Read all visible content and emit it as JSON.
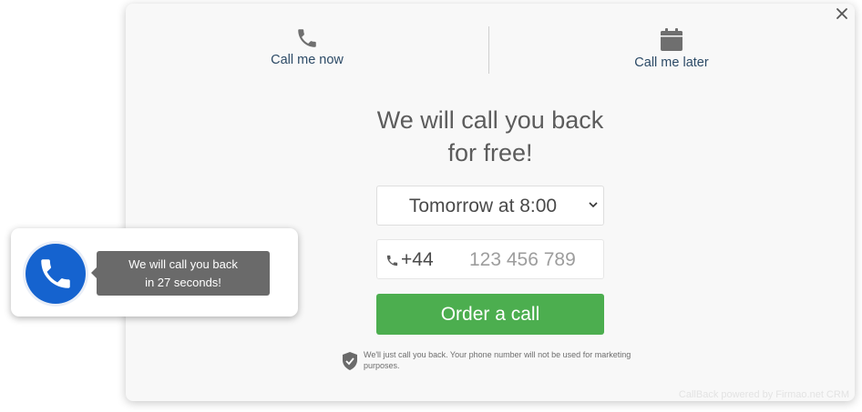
{
  "tabs": {
    "call_now": {
      "label": "Call me now",
      "icon": "phone-icon"
    },
    "call_later": {
      "label": "Call me later",
      "icon": "calendar-icon"
    }
  },
  "close": {
    "icon": "close-icon"
  },
  "headline": {
    "line1": "We will call you back",
    "line2": "for free!"
  },
  "time_select": {
    "selected": "Tomorrow at 8:00",
    "icon": "chevron-down-icon"
  },
  "phone_field": {
    "prefix": "+44",
    "placeholder": "123 456 789",
    "icon": "phone-icon"
  },
  "order_button": {
    "label": "Order a call"
  },
  "disclaimer": {
    "text": "We'll just call you back. Your phone number will not be used for marketing purposes.",
    "icon": "shield-icon"
  },
  "powered_by": "CallBack powered by Firmao.net CRM",
  "widget": {
    "icon": "phone-icon",
    "message_line1": "We will call you back",
    "message_line2": "in 27 seconds!"
  },
  "colors": {
    "accent_green": "#4cae4f",
    "widget_blue": "#1563cf",
    "tab_text": "#2c4a66",
    "bubble_bg": "#6a6a6a"
  }
}
